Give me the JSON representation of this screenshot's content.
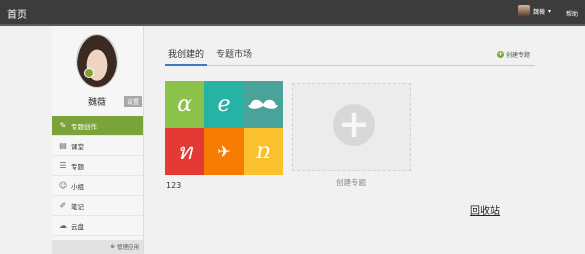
{
  "topbar": {
    "home": "首页",
    "username": "魏薇",
    "help": "帮助",
    "user_menu_icon": "chevron-down-icon"
  },
  "sidebar": {
    "name": "魏薇",
    "settings": "设置",
    "nav": [
      {
        "label": "专题创作",
        "icon": "topic-icon",
        "active": true
      },
      {
        "label": "课堂",
        "icon": "classroom-icon",
        "active": false
      },
      {
        "label": "专题",
        "icon": "list-icon",
        "active": false
      },
      {
        "label": "小组",
        "icon": "group-icon",
        "active": false
      },
      {
        "label": "笔记",
        "icon": "note-icon",
        "active": false
      },
      {
        "label": "云盘",
        "icon": "cloud-icon",
        "active": false
      }
    ],
    "manage": "管理应用"
  },
  "tabs": {
    "mine": "我创建的",
    "market": "专题市场",
    "create_link": "创建专题"
  },
  "topic": {
    "title": "123",
    "tiles": [
      {
        "glyph": "ɑ",
        "color": "#8bc34a"
      },
      {
        "glyph": "e",
        "color": "#26b3a6"
      },
      {
        "glyph": "",
        "color": "#4aa39b"
      },
      {
        "glyph": "ท",
        "color": "#e53935"
      },
      {
        "glyph": "✈",
        "color": "#f57c00"
      },
      {
        "glyph": "ռ",
        "color": "#fbc02d"
      }
    ]
  },
  "new_topic": {
    "label": "创建专题",
    "icon": "plus-icon"
  },
  "recycle_bin": "回收站",
  "colors": {
    "accent": "#7aa33a",
    "tab_underline": "#3b7bbd",
    "topbar": "#3c3c3c"
  }
}
